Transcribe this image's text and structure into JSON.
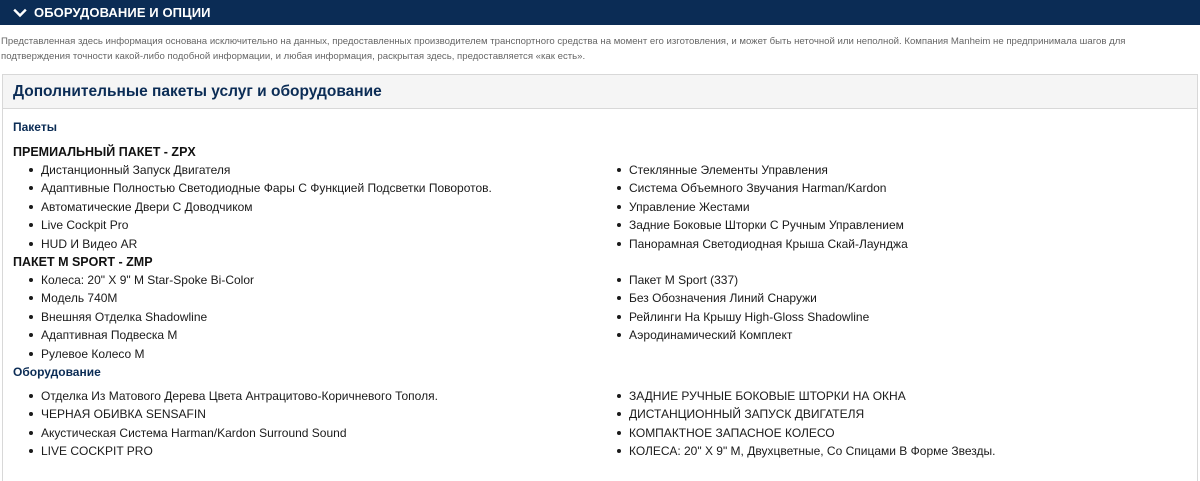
{
  "header": {
    "title": "ОБОРУДОВАНИЕ И ОПЦИИ",
    "toggle_icon": "chevron-down-icon"
  },
  "disclaimer": "Представленная здесь информация основана исключительно на данных, предоставленных производителем транспортного средства на момент его изготовления, и может быть неточной или неполной. Компания Manheim не предпринимала шагов для подтверждения точности какой-либо подобной информации, и любая информация, раскрытая здесь, предоставляется «как есть».",
  "panel": {
    "title": "Дополнительные пакеты услуг и оборудование",
    "packages_title": "Пакеты",
    "packages": [
      {
        "name": "ПРЕМИАЛЬНЫЙ ПАКЕТ - ZPX",
        "left": [
          "Дистанционный Запуск Двигателя",
          "Адаптивные Полностью Светодиодные Фары С Функцией Подсветки Поворотов.",
          "Автоматические Двери С Доводчиком",
          "Live Cockpit Pro",
          "HUD И Видео AR"
        ],
        "right": [
          "Стеклянные Элементы Управления",
          "Система Объемного Звучания Harman/Kardon",
          "Управление Жестами",
          "Задние Боковые Шторки С Ручным Управлением",
          "Панорамная Светодиодная Крыша Скай-Лаунджа"
        ]
      },
      {
        "name": "ПАКЕТ M SPORT - ZMP",
        "left": [
          "Колеса: 20\" X 9\" M Star-Spoke Bi-Color",
          "Модель 740M",
          "Внешняя Отделка Shadowline",
          "Адаптивная Подвеска M",
          "Рулевое Колесо M"
        ],
        "right": [
          "Пакет M Sport (337)",
          "Без Обозначения Линий Снаружи",
          "Рейлинги На Крышу High-Gloss Shadowline",
          "Аэродинамический Комплект"
        ]
      }
    ],
    "equipment_title": "Оборудование",
    "equipment": {
      "left": [
        "Отделка Из Матового Дерева Цвета Антрацитово-Коричневого Тополя.",
        "ЧЕРНАЯ ОБИВКА SENSAFIN",
        "Акустическая Система Harman/Kardon Surround Sound",
        "LIVE COCKPIT PRO"
      ],
      "right": [
        "ЗАДНИЕ РУЧНЫЕ БОКОВЫЕ ШТОРКИ НА ОКНА",
        "ДИСТАНЦИОННЫЙ ЗАПУСК ДВИГАТЕЛЯ",
        "КОМПАКТНОЕ ЗАПАСНОЕ КОЛЕСО",
        "КОЛЕСА: 20\" X 9\" M, Двухцветные, Со Спицами В Форме Звезды."
      ]
    }
  },
  "colors": {
    "header_bg": "#0b2c55",
    "accent_text": "#0b2c55",
    "panel_header_bg": "#f5f5f5"
  }
}
